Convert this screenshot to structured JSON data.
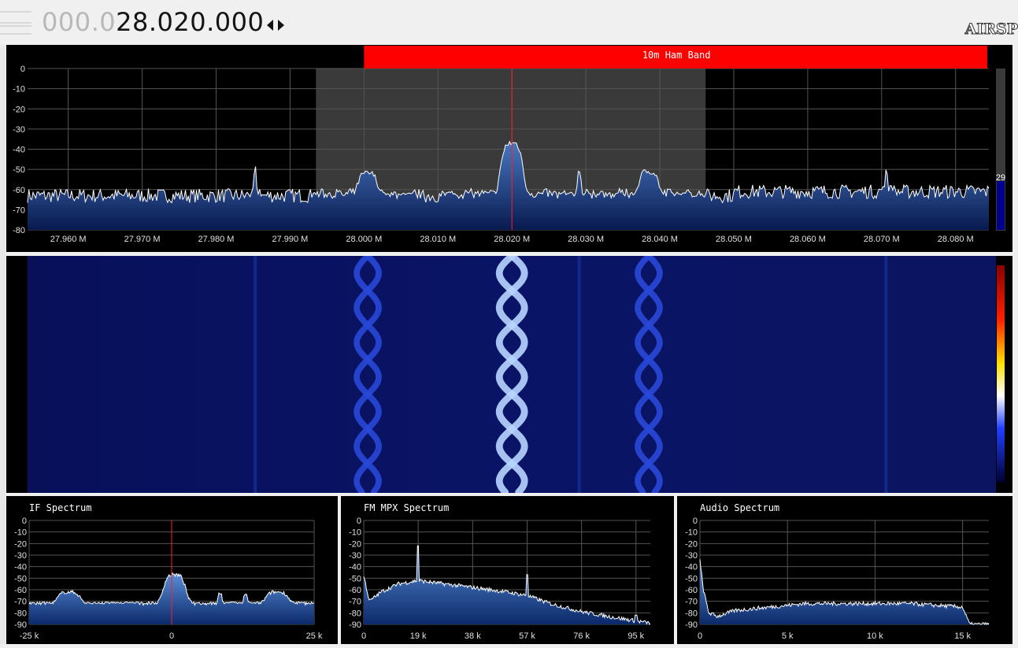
{
  "header": {
    "frequency_dim": "000.0",
    "frequency_bright": "28.020.000",
    "logo_text": "AIRSP"
  },
  "spectrum": {
    "band_label": "10m Ham Band",
    "y_ticks": [
      "0",
      "-10",
      "-20",
      "-30",
      "-40",
      "-50",
      "-60",
      "-70",
      "-80"
    ],
    "x_ticks": [
      "27.960 M",
      "27.970 M",
      "27.980 M",
      "27.990 M",
      "28.000 M",
      "28.010 M",
      "28.020 M",
      "28.030 M",
      "28.040 M",
      "28.050 M",
      "28.060 M",
      "28.070 M",
      "28.080 M"
    ],
    "level_value": "29",
    "colors": {
      "band_bar": "#ff0000",
      "trace": "#ffffff",
      "fill": "#1a3a8a",
      "center_line": "#ff0000",
      "filter_shade": "#3a3a3a"
    }
  },
  "chart_data": [
    {
      "type": "area",
      "name_ref": "main-spectrum",
      "x_unit": "MHz",
      "xlim": [
        27.9545,
        28.0845
      ],
      "ylim": [
        -80,
        0
      ],
      "center": 28.02,
      "filter_range": [
        27.9935,
        28.0462
      ],
      "band_range": [
        28.0,
        28.0845
      ],
      "noise_floor": -63,
      "peaks": [
        {
          "x": 27.9853,
          "y": -49,
          "w": 0.0002
        },
        {
          "x": 28.0005,
          "y": -52,
          "w": 0.0015
        },
        {
          "x": 28.02,
          "y": -37,
          "w": 0.0017
        },
        {
          "x": 28.0291,
          "y": -50,
          "w": 0.0003
        },
        {
          "x": 28.0385,
          "y": -51,
          "w": 0.0015
        },
        {
          "x": 28.0706,
          "y": -51,
          "w": 0.0002
        }
      ]
    },
    {
      "type": "area",
      "title": "IF Spectrum",
      "y_ticks": [
        "0",
        "-10",
        "-20",
        "-30",
        "-40",
        "-50",
        "-60",
        "-70",
        "-80",
        "-90"
      ],
      "x_ticks": [
        "-25 k",
        "0",
        "25 k"
      ],
      "xlim": [
        -25,
        25
      ],
      "ylim": [
        -90,
        0
      ],
      "noise_floor": -72,
      "peaks": [
        {
          "x": -18,
          "y": -62,
          "w": 2.2
        },
        {
          "x": 0.5,
          "y": -47,
          "w": 2.2
        },
        {
          "x": 8.5,
          "y": -63,
          "w": 0.4
        },
        {
          "x": 13,
          "y": -64,
          "w": 0.4
        },
        {
          "x": 18.5,
          "y": -62,
          "w": 2.2
        }
      ]
    },
    {
      "type": "area",
      "title": "FM MPX Spectrum",
      "y_ticks": [
        "0",
        "-10",
        "-20",
        "-30",
        "-40",
        "-50",
        "-60",
        "-70",
        "-80",
        "-90"
      ],
      "x_ticks": [
        "0",
        "19 k",
        "38 k",
        "57 k",
        "76 k",
        "95 k"
      ],
      "xlim": [
        0,
        100
      ],
      "ylim": [
        -90,
        0
      ],
      "points": [
        [
          0,
          -48
        ],
        [
          2,
          -70
        ],
        [
          6,
          -62
        ],
        [
          12,
          -55
        ],
        [
          19,
          -52
        ],
        [
          25,
          -54
        ],
        [
          38,
          -58
        ],
        [
          50,
          -62
        ],
        [
          57,
          -65
        ],
        [
          65,
          -72
        ],
        [
          76,
          -79
        ],
        [
          85,
          -83
        ],
        [
          95,
          -87
        ],
        [
          100,
          -89
        ]
      ],
      "spikes": [
        {
          "x": 19,
          "y": -22
        },
        {
          "x": 57,
          "y": -47
        },
        {
          "x": 95,
          "y": -82
        }
      ]
    },
    {
      "type": "area",
      "title": "Audio Spectrum",
      "y_ticks": [
        "0",
        "-10",
        "-20",
        "-30",
        "-40",
        "-50",
        "-60",
        "-70",
        "-80",
        "-90"
      ],
      "x_ticks": [
        "0",
        "5 k",
        "10 k",
        "15 k"
      ],
      "xlim": [
        0,
        16.5
      ],
      "ylim": [
        -90,
        0
      ],
      "points": [
        [
          0,
          -35
        ],
        [
          0.2,
          -60
        ],
        [
          0.5,
          -80
        ],
        [
          1,
          -83
        ],
        [
          2,
          -78
        ],
        [
          4,
          -75
        ],
        [
          6,
          -72
        ],
        [
          8,
          -72
        ],
        [
          10,
          -72
        ],
        [
          12,
          -72
        ],
        [
          14,
          -74
        ],
        [
          15,
          -75
        ],
        [
          15.4,
          -90
        ]
      ]
    }
  ]
}
